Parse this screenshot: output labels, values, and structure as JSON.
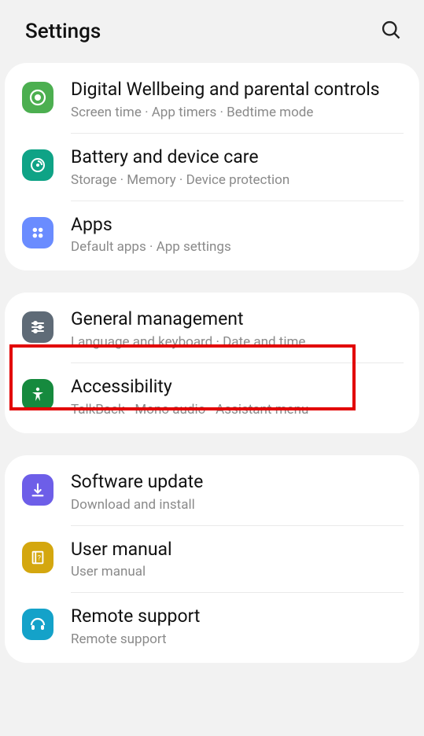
{
  "header": {
    "title": "Settings"
  },
  "icons": {
    "search": "search-icon"
  },
  "groups": [
    {
      "items": [
        {
          "title": "Digital Wellbeing and parental controls",
          "sub": "Screen time  ·  App timers  ·  Bedtime mode",
          "icon": "wellbeing",
          "icon_color": "#4caf50"
        },
        {
          "title": "Battery and device care",
          "sub": "Storage  ·  Memory  ·  Device protection",
          "icon": "device-care",
          "icon_color": "#0fa386"
        },
        {
          "title": "Apps",
          "sub": "Default apps  ·  App settings",
          "icon": "apps",
          "icon_color": "#6a8cff"
        }
      ]
    },
    {
      "items": [
        {
          "title": "General management",
          "sub": "Language and keyboard  ·  Date and time",
          "icon": "general",
          "icon_color": "#5f6b77",
          "highlight": true
        },
        {
          "title": "Accessibility",
          "sub": "TalkBack  ·  Mono audio  ·  Assistant menu",
          "icon": "accessibility",
          "icon_color": "#168a3e"
        }
      ]
    },
    {
      "items": [
        {
          "title": "Software update",
          "sub": "Download and install",
          "icon": "update",
          "icon_color": "#6d5ee8"
        },
        {
          "title": "User manual",
          "sub": "User manual",
          "icon": "manual",
          "icon_color": "#d4a70f"
        },
        {
          "title": "Remote support",
          "sub": "Remote support",
          "icon": "remote",
          "icon_color": "#14a2c9"
        }
      ]
    }
  ]
}
